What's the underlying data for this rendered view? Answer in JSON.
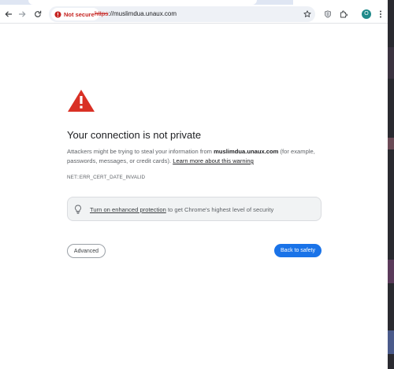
{
  "browser": {
    "nav": {
      "back_icon": "arrow-left-icon",
      "forward_icon": "arrow-right-icon",
      "reload_icon": "reload-icon"
    },
    "omnibox": {
      "security_chip_label": "Not secure",
      "url_scheme": "https",
      "url_rest": "://muslimdua.unaux.com"
    },
    "profile_initial": "O"
  },
  "page": {
    "title": "Your connection is not private",
    "para_prefix": "Attackers might be trying to steal your information from ",
    "host": "muslimdua.unaux.com",
    "para_suffix": " (for example, passwords, messages, or credit cards). ",
    "learn_more": "Learn more about this warning",
    "error_code": "NET::ERR_CERT_DATE_INVALID",
    "promo_link": "Turn on enhanced protection",
    "promo_text": " to get Chrome's highest level of security",
    "advanced_button": "Advanced",
    "back_button": "Back to safety"
  },
  "colors": {
    "accent": "#1a73e8",
    "warning": "#d93025",
    "danger_text": "#c5221f"
  }
}
